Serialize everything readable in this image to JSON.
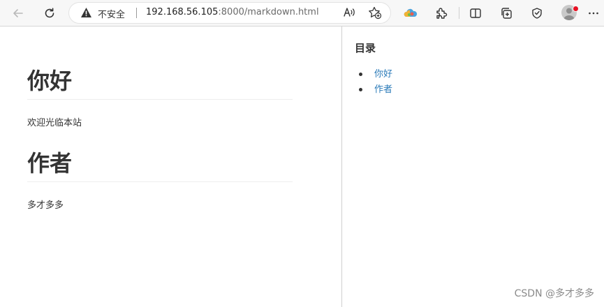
{
  "browser": {
    "security_label": "不安全",
    "url_host": "192.168.56.105",
    "url_path": ":8000/markdown.html"
  },
  "icons": {
    "back": "arrow-left-icon",
    "refresh": "refresh-icon",
    "warning": "warning-triangle-icon",
    "read_aloud": "read-aloud-icon",
    "favorite": "add-favorite-icon",
    "extension_cloud": "cloud-extension-icon",
    "extensions": "puzzle-icon",
    "split_screen": "split-screen-icon",
    "collections": "collections-icon",
    "browser_essentials": "heart-shield-icon",
    "profile": "profile-avatar-icon",
    "more": "more-icon"
  },
  "article": {
    "sections": [
      {
        "heading": "你好",
        "text": "欢迎光临本站"
      },
      {
        "heading": "作者",
        "text": "多才多多"
      }
    ]
  },
  "toc": {
    "title": "目录",
    "items": [
      {
        "label": "你好"
      },
      {
        "label": "作者"
      }
    ]
  },
  "watermark": "CSDN @多才多多",
  "colors": {
    "link": "#2a7ab8",
    "text": "#333333",
    "notification_dot": "#e81123"
  }
}
